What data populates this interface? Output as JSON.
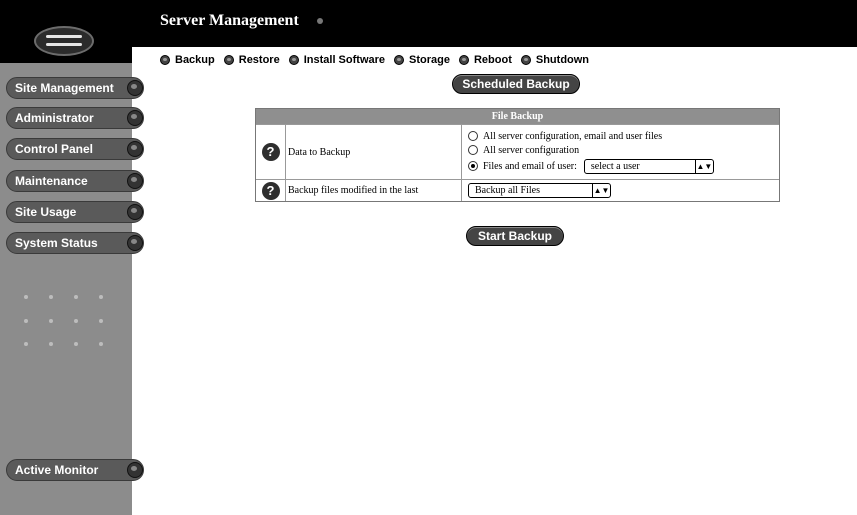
{
  "header": {
    "title": "Server Management"
  },
  "sidebar": {
    "items": [
      {
        "label": "Site Management"
      },
      {
        "label": "Administrator"
      },
      {
        "label": "Control Panel"
      },
      {
        "label": "Maintenance"
      },
      {
        "label": "Site Usage"
      },
      {
        "label": "System Status"
      },
      {
        "label": "Active Monitor"
      }
    ]
  },
  "subnav": {
    "items": [
      {
        "label": "Backup"
      },
      {
        "label": "Restore"
      },
      {
        "label": "Install Software"
      },
      {
        "label": "Storage"
      },
      {
        "label": "Reboot"
      },
      {
        "label": "Shutdown"
      }
    ]
  },
  "main": {
    "scheduled_backup_label": "Scheduled Backup",
    "start_backup_label": "Start Backup",
    "form": {
      "title": "File Backup",
      "row1": {
        "label": "Data to Backup",
        "options": [
          "All server configuration, email and user files",
          "All server configuration",
          "Files and email of user:"
        ],
        "selected_index": 2,
        "user_select_value": "select a user"
      },
      "row2": {
        "label": "Backup files modified in the last",
        "select_value": "Backup all Files"
      }
    }
  },
  "colors": {
    "sidebar": "#8c8c8c",
    "header": "#000000",
    "table_header": "#8f8f8f"
  }
}
